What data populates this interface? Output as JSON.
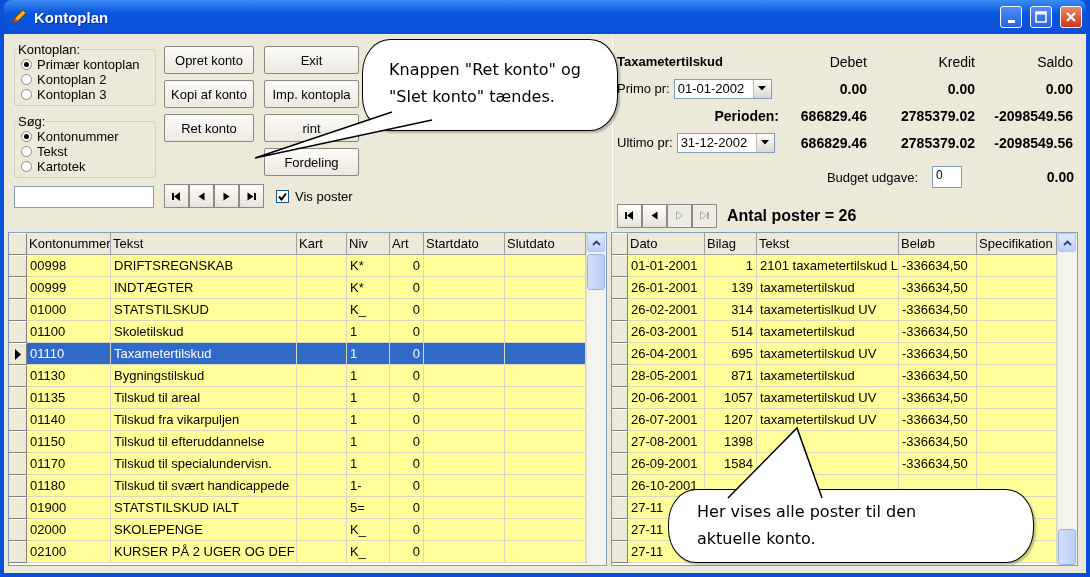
{
  "window": {
    "title": "Kontoplan"
  },
  "controls": {
    "kontoplan_group": {
      "title": "Kontoplan:",
      "options": [
        {
          "label": "Primær kontoplan",
          "selected": true
        },
        {
          "label": "Kontoplan 2",
          "selected": false
        },
        {
          "label": "Kontoplan 3",
          "selected": false
        }
      ]
    },
    "search_group": {
      "title": "Søg:",
      "options": [
        {
          "label": "Kontonummer",
          "selected": true
        },
        {
          "label": "Tekst",
          "selected": false
        },
        {
          "label": "Kartotek",
          "selected": false
        }
      ]
    },
    "buttons_column_1": [
      {
        "label": "Opret konto"
      },
      {
        "label": "Kopi af konto"
      },
      {
        "label": "Ret konto"
      }
    ],
    "buttons_column_2": [
      {
        "label": "Exit"
      },
      {
        "label": "Imp. kontopla"
      },
      {
        "label": "rint"
      },
      {
        "label": "Fordeling"
      }
    ],
    "nav_buttons": [
      {
        "kind": "first",
        "disabled": false
      },
      {
        "kind": "prev",
        "disabled": false
      },
      {
        "kind": "next",
        "disabled": false
      },
      {
        "kind": "last",
        "disabled": false
      }
    ],
    "vis_poster": {
      "label": "Vis poster",
      "checked": true
    }
  },
  "summary": {
    "account": "Taxametertilskud",
    "headers": [
      "Debet",
      "Kredit",
      "Saldo"
    ],
    "primo": {
      "label": "Primo pr:",
      "date": "01-01-2002",
      "values": [
        "0.00",
        "0.00",
        "0.00"
      ]
    },
    "period": {
      "label": "Perioden:",
      "values": [
        "686829.46",
        "2785379.02",
        "-2098549.56"
      ]
    },
    "ultimo": {
      "label": "Ultimo pr:",
      "date": "31-12-2002",
      "values": [
        "686829.46",
        "2785379.02",
        "-2098549.56"
      ]
    },
    "budget": {
      "label": "Budget udgave:",
      "value": "0",
      "saldo": "0.00"
    },
    "nav_buttons": [
      {
        "kind": "first",
        "disabled": false
      },
      {
        "kind": "prev",
        "disabled": false
      },
      {
        "kind": "next",
        "disabled": true
      },
      {
        "kind": "last",
        "disabled": true
      }
    ],
    "count": "Antal poster = 26"
  },
  "accounts_table": {
    "columns": [
      "Kontonummer",
      "Tekst",
      "Kart",
      "Niv",
      "Art",
      "Startdato",
      "Slutdato"
    ],
    "rows": [
      {
        "cells": [
          "00998",
          "DRIFTSREGNSKAB",
          null,
          "K*",
          "0"
        ],
        "selected": false
      },
      {
        "cells": [
          "00999",
          "INDTÆGTER",
          null,
          "K*",
          "0"
        ],
        "selected": false
      },
      {
        "cells": [
          "01000",
          "STATSTILSKUD",
          null,
          "K_",
          "0"
        ],
        "selected": false
      },
      {
        "cells": [
          "01100",
          "Skoletilskud",
          null,
          "1",
          "0"
        ],
        "selected": false
      },
      {
        "cells": [
          "01110",
          "Taxametertilskud",
          null,
          "1",
          "0"
        ],
        "selected": true
      },
      {
        "cells": [
          "01130",
          "Bygningstilskud",
          null,
          "1",
          "0"
        ],
        "selected": false
      },
      {
        "cells": [
          "01135",
          "Tilskud til areal",
          null,
          "1",
          "0"
        ],
        "selected": false
      },
      {
        "cells": [
          "01140",
          "Tilskud fra vikarpuljen",
          null,
          "1",
          "0"
        ],
        "selected": false
      },
      {
        "cells": [
          "01150",
          "Tilskud til efteruddannelse",
          null,
          "1",
          "0"
        ],
        "selected": false
      },
      {
        "cells": [
          "01170",
          "Tilskud til specialundervisn.",
          null,
          "1",
          "0"
        ],
        "selected": false
      },
      {
        "cells": [
          "01180",
          "Tilskud til svært handicappede",
          null,
          "1-",
          "0"
        ],
        "selected": false
      },
      {
        "cells": [
          "01900",
          "STATSTILSKUD IALT",
          null,
          "5=",
          "0"
        ],
        "selected": false
      },
      {
        "cells": [
          "02000",
          "SKOLEPENGE",
          null,
          "K_",
          "0"
        ],
        "selected": false
      },
      {
        "cells": [
          "02100",
          "KURSER PÅ 2 UGER OG DEF",
          null,
          "K_",
          "0"
        ],
        "selected": false
      }
    ]
  },
  "postings_table": {
    "columns": [
      "Dato",
      "Bilag",
      "Tekst",
      "Beløb",
      "Specifikation"
    ],
    "rows": [
      {
        "cells": [
          "01-01-2001",
          "1",
          "2101 taxametertilskud L",
          "-336634,50"
        ]
      },
      {
        "cells": [
          "26-01-2001",
          "139",
          "taxametertilskud",
          "-336634,50"
        ]
      },
      {
        "cells": [
          "26-02-2001",
          "314",
          "taxametertislkud UV",
          "-336634,50"
        ]
      },
      {
        "cells": [
          "26-03-2001",
          "514",
          "taxametertilskud",
          "-336634,50"
        ]
      },
      {
        "cells": [
          "26-04-2001",
          "695",
          "taxametertilskud UV",
          "-336634,50"
        ]
      },
      {
        "cells": [
          "28-05-2001",
          "871",
          "taxametertilskud",
          "-336634,50"
        ]
      },
      {
        "cells": [
          "20-06-2001",
          "1057",
          "taxametertilskud UV",
          "-336634,50"
        ]
      },
      {
        "cells": [
          "26-07-2001",
          "1207",
          "taxametertilskud UV",
          "-336634,50"
        ]
      },
      {
        "cells": [
          "27-08-2001",
          "1398",
          null,
          "-336634,50"
        ]
      },
      {
        "cells": [
          "26-09-2001",
          "1584",
          null,
          "-336634,50"
        ]
      },
      {
        "cells": [
          "26-10-2001"
        ]
      },
      {
        "cells": [
          "27-11"
        ]
      },
      {
        "cells": [
          "27-11"
        ]
      },
      {
        "cells": [
          "27-11"
        ]
      }
    ]
  },
  "callouts": [
    {
      "text": "Knappen \"Ret konto\" og \"Slet konto\" tændes."
    },
    {
      "text": "Her vises alle poster til den aktuelle konto."
    }
  ]
}
